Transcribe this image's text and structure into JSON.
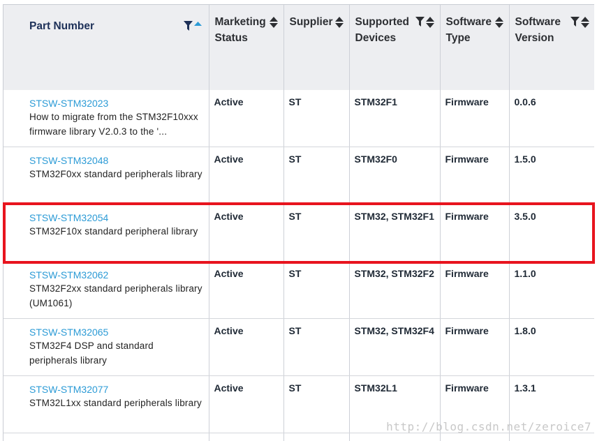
{
  "columns": [
    {
      "label": "Part Number",
      "filter": true,
      "sort": "asc"
    },
    {
      "label": "Marketing Status",
      "filter": false,
      "sort": "both"
    },
    {
      "label": "Supplier",
      "filter": false,
      "sort": "both"
    },
    {
      "label": "Supported Devices",
      "filter": true,
      "sort": "both"
    },
    {
      "label": "Software Type",
      "filter": false,
      "sort": "both"
    },
    {
      "label": "Software Version",
      "filter": true,
      "sort": "both"
    }
  ],
  "rows": [
    {
      "part": "STSW-STM32023",
      "desc": "How to migrate from the STM32F10xxx firmware library V2.0.3 to the '...",
      "status": "Active",
      "supplier": "ST",
      "devices": "STM32F1",
      "type": "Firmware",
      "version": "0.0.6"
    },
    {
      "part": "STSW-STM32048",
      "desc": "STM32F0xx standard peripherals library",
      "status": "Active",
      "supplier": "ST",
      "devices": "STM32F0",
      "type": "Firmware",
      "version": "1.5.0"
    },
    {
      "part": "STSW-STM32054",
      "desc": "STM32F10x standard peripheral library",
      "status": "Active",
      "supplier": "ST",
      "devices": "STM32, STM32F1",
      "type": "Firmware",
      "version": "3.5.0"
    },
    {
      "part": "STSW-STM32062",
      "desc": "STM32F2xx standard peripherals library (UM1061)",
      "status": "Active",
      "supplier": "ST",
      "devices": "STM32, STM32F2",
      "type": "Firmware",
      "version": "1.1.0"
    },
    {
      "part": "STSW-STM32065",
      "desc": "STM32F4 DSP and standard peripherals library",
      "status": "Active",
      "supplier": "ST",
      "devices": "STM32, STM32F4",
      "type": "Firmware",
      "version": "1.8.0"
    },
    {
      "part": "STSW-STM32077",
      "desc": "STM32L1xx standard peripherals library",
      "status": "Active",
      "supplier": "ST",
      "devices": "STM32L1",
      "type": "Firmware",
      "version": "1.3.1"
    }
  ],
  "highlighted_row": 2,
  "watermark": "http://blog.csdn.net/zeroice7",
  "colors": {
    "link": "#2c9bd6",
    "header_bg": "#edeef1",
    "highlight": "#e8141e"
  }
}
